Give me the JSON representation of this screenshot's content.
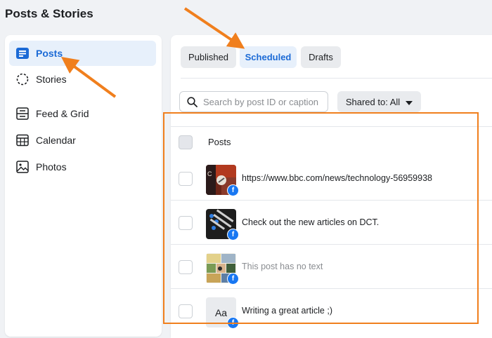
{
  "page": {
    "title": "Posts & Stories"
  },
  "sidebar": {
    "items": [
      {
        "label": "Posts",
        "icon": "posts-icon",
        "active": true
      },
      {
        "label": "Stories",
        "icon": "stories-icon",
        "active": false
      },
      {
        "label": "Feed & Grid",
        "icon": "feed-grid-icon",
        "active": false
      },
      {
        "label": "Calendar",
        "icon": "calendar-icon",
        "active": false
      },
      {
        "label": "Photos",
        "icon": "photos-icon",
        "active": false
      }
    ]
  },
  "tabs": [
    {
      "label": "Published",
      "active": false
    },
    {
      "label": "Scheduled",
      "active": true
    },
    {
      "label": "Drafts",
      "active": false
    }
  ],
  "search": {
    "placeholder": "Search by post ID or caption",
    "value": ""
  },
  "filter": {
    "label": "Shared to: All"
  },
  "table": {
    "header": "Posts",
    "rows": [
      {
        "caption": "https://www.bbc.com/news/technology-56959938",
        "muted": false,
        "platform": "facebook-icon"
      },
      {
        "caption": "Check out the new articles on DCT.",
        "muted": false,
        "platform": "facebook-icon"
      },
      {
        "caption": "This post has no text",
        "muted": true,
        "platform": "facebook-icon"
      },
      {
        "caption": "Writing a great article ;)",
        "muted": false,
        "platform": "facebook-icon",
        "thumb_text": "Aa"
      }
    ]
  },
  "colors": {
    "accent": "#1b6ad6",
    "active_bg": "#e7f0fb",
    "annotation": "#f07f1d",
    "facebook": "#1877f2"
  }
}
